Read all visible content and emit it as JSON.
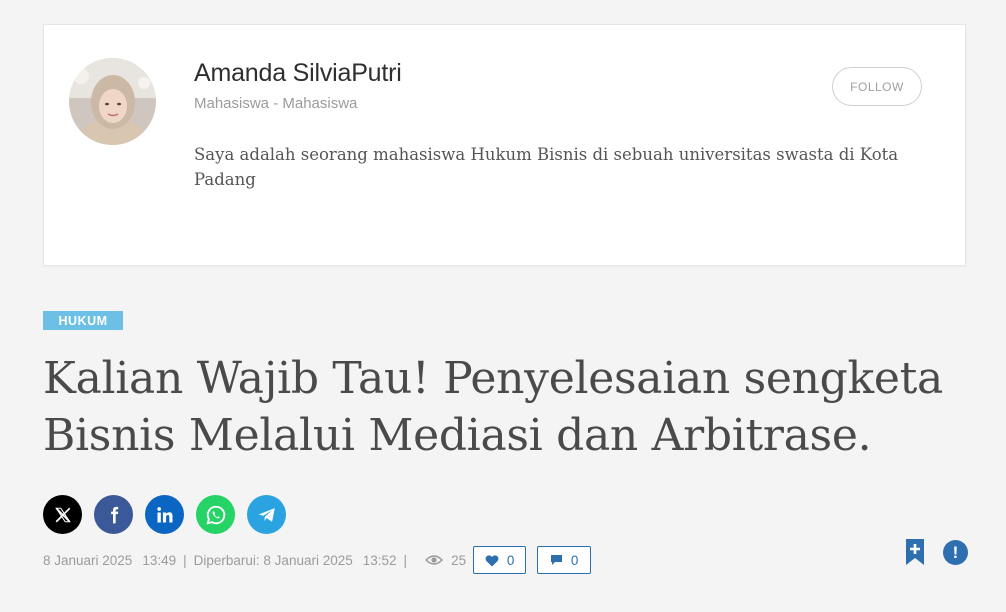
{
  "author": {
    "name": "Amanda SilviaPutri",
    "role": "Mahasiswa - Mahasiswa",
    "bio": "Saya adalah seorang mahasiswa Hukum Bisnis di sebuah universitas swasta di Kota Padang",
    "follow_label": "FOLLOW"
  },
  "article": {
    "category": "HUKUM",
    "title": "Kalian Wajib Tau! Penyelesaian sengketa Bisnis Melalui Mediasi dan Arbitrase."
  },
  "share": {
    "buttons": [
      {
        "name": "x-twitter",
        "icon": "x-icon",
        "color": "#000000"
      },
      {
        "name": "facebook",
        "icon": "facebook-icon",
        "color": "#3b5998"
      },
      {
        "name": "linkedin",
        "icon": "linkedin-icon",
        "color": "#0a66c2"
      },
      {
        "name": "whatsapp",
        "icon": "whatsapp-icon",
        "color": "#25d366"
      },
      {
        "name": "telegram",
        "icon": "telegram-icon",
        "color": "#2aa3e0"
      }
    ]
  },
  "meta": {
    "published_date": "8 Januari 2025",
    "published_time": "13:49",
    "updated_label": "Diperbarui: 8 Januari 2025",
    "updated_time": "13:52",
    "separator": "|",
    "views": "25",
    "likes": "0",
    "comments": "0"
  },
  "colors": {
    "accent": "#2e6fb0",
    "category_bg": "#6cc0e5",
    "background": "#f4f4f4"
  },
  "icons": {
    "bookmark": "bookmark-plus-icon",
    "report": "exclamation-icon",
    "views": "eye-icon",
    "likes": "heart-icon",
    "comments": "comment-icon"
  }
}
